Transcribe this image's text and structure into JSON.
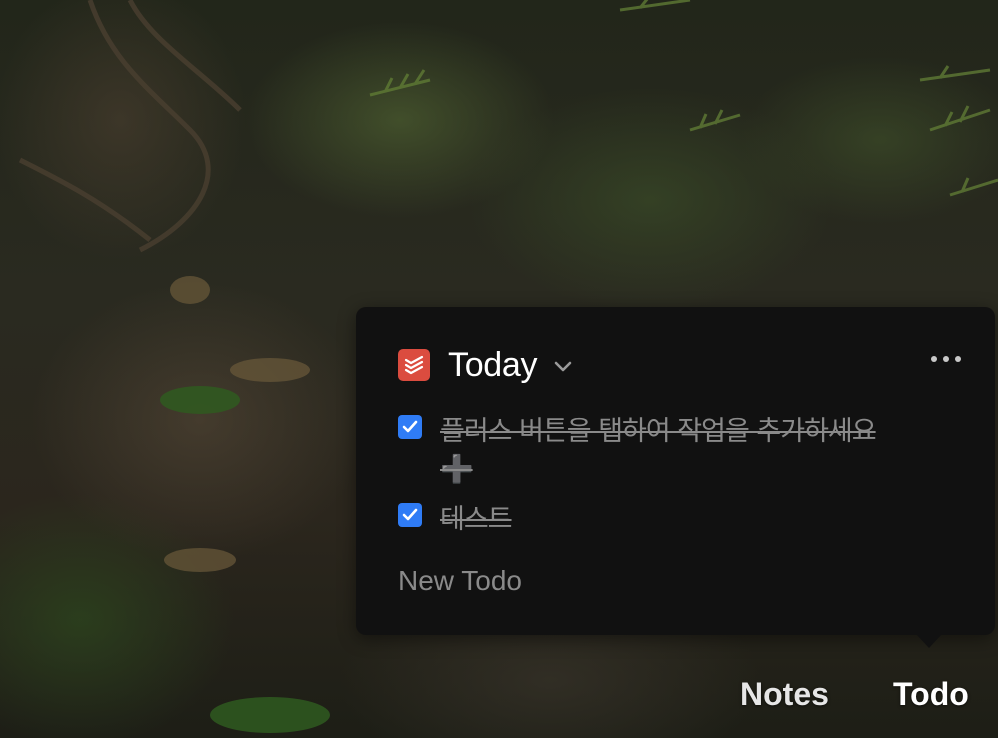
{
  "widget": {
    "app_icon": "todoist-icon",
    "title": "Today",
    "dropdown_icon": "chevron-down-icon",
    "more_icon": "more-horizontal-icon",
    "items": [
      {
        "text": "플러스 버튼을 탭하여 작업을 추가하세요 ➕",
        "completed": true
      },
      {
        "text": "테스트",
        "completed": true
      }
    ],
    "new_todo_placeholder": "New Todo"
  },
  "tabs": {
    "notes": "Notes",
    "todo": "Todo"
  },
  "colors": {
    "accent": "#2f7cf6",
    "app_icon": "#db4c3f",
    "panel": "#111111"
  }
}
